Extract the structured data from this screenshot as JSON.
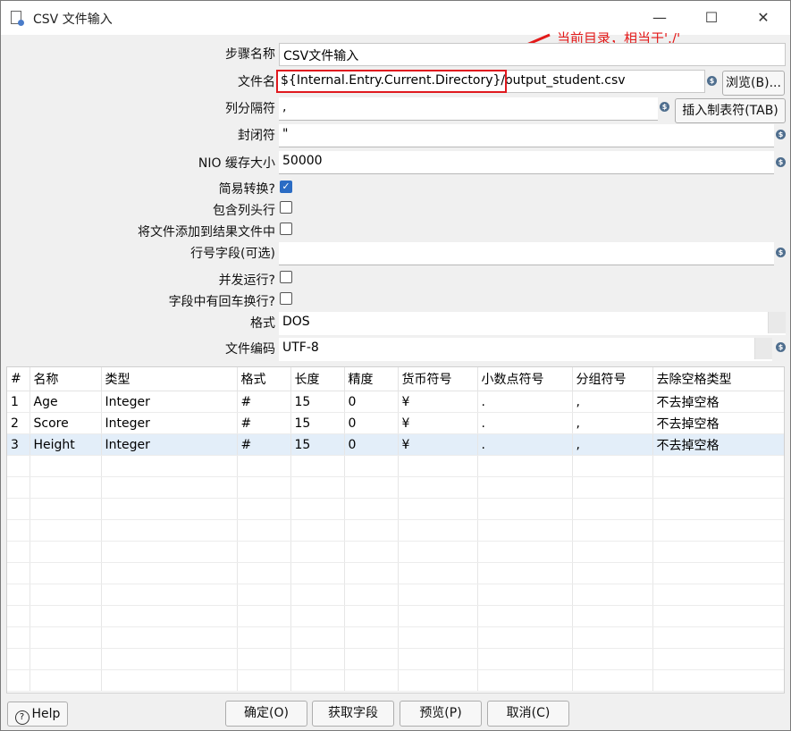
{
  "window": {
    "title": "CSV 文件输入",
    "minimize": "—",
    "maximize": "☐",
    "close": "✕"
  },
  "annotation": "当前目录，相当于'./'",
  "form": {
    "step_name_label": "步骤名称",
    "step_name_value": "CSV文件输入",
    "filename_label": "文件名",
    "filename_value": "${Internal.Entry.Current.Directory}/output_student.csv",
    "browse_button": "浏览(B)...",
    "delimiter_label": "列分隔符",
    "delimiter_value": ",",
    "insert_tab_button": "插入制表符(TAB)",
    "enclosure_label": "封闭符",
    "enclosure_value": "\"",
    "nio_label": "NIO 缓存大小",
    "nio_value": "50000",
    "lazy_label": "简易转换?",
    "lazy_checked": true,
    "header_label": "包含列头行",
    "header_checked": false,
    "add_result_label": "将文件添加到结果文件中",
    "add_result_checked": false,
    "rownum_label": "行号字段(可选)",
    "rownum_value": "",
    "parallel_label": "并发运行?",
    "parallel_checked": false,
    "newline_label": "字段中有回车换行?",
    "newline_checked": false,
    "format_label": "格式",
    "format_value": "DOS",
    "encoding_label": "文件编码",
    "encoding_value": "UTF-8"
  },
  "grid": {
    "sort_marker": "^",
    "columns": [
      "#",
      "名称",
      "类型",
      "格式",
      "长度",
      "精度",
      "货币符号",
      "小数点符号",
      "分组符号",
      "去除空格类型"
    ],
    "rows": [
      [
        "1",
        "Age",
        "Integer",
        "#",
        "15",
        "0",
        "¥",
        ".",
        ",",
        "不去掉空格"
      ],
      [
        "2",
        "Score",
        "Integer",
        "#",
        "15",
        "0",
        "¥",
        ".",
        ",",
        "不去掉空格"
      ],
      [
        "3",
        "Height",
        "Integer",
        "#",
        "15",
        "0",
        "¥",
        ".",
        ",",
        "不去掉空格"
      ]
    ],
    "selected_row": 3
  },
  "footer": {
    "help": "Help",
    "ok": "确定(O)",
    "get_fields": "获取字段",
    "preview": "预览(P)",
    "cancel": "取消(C)"
  },
  "colors": {
    "annotation": "#e31a1a",
    "highlight_box": "#e0191f",
    "checkbox_checked": "#2b6cc4",
    "selected_row": "#e3eef9"
  }
}
